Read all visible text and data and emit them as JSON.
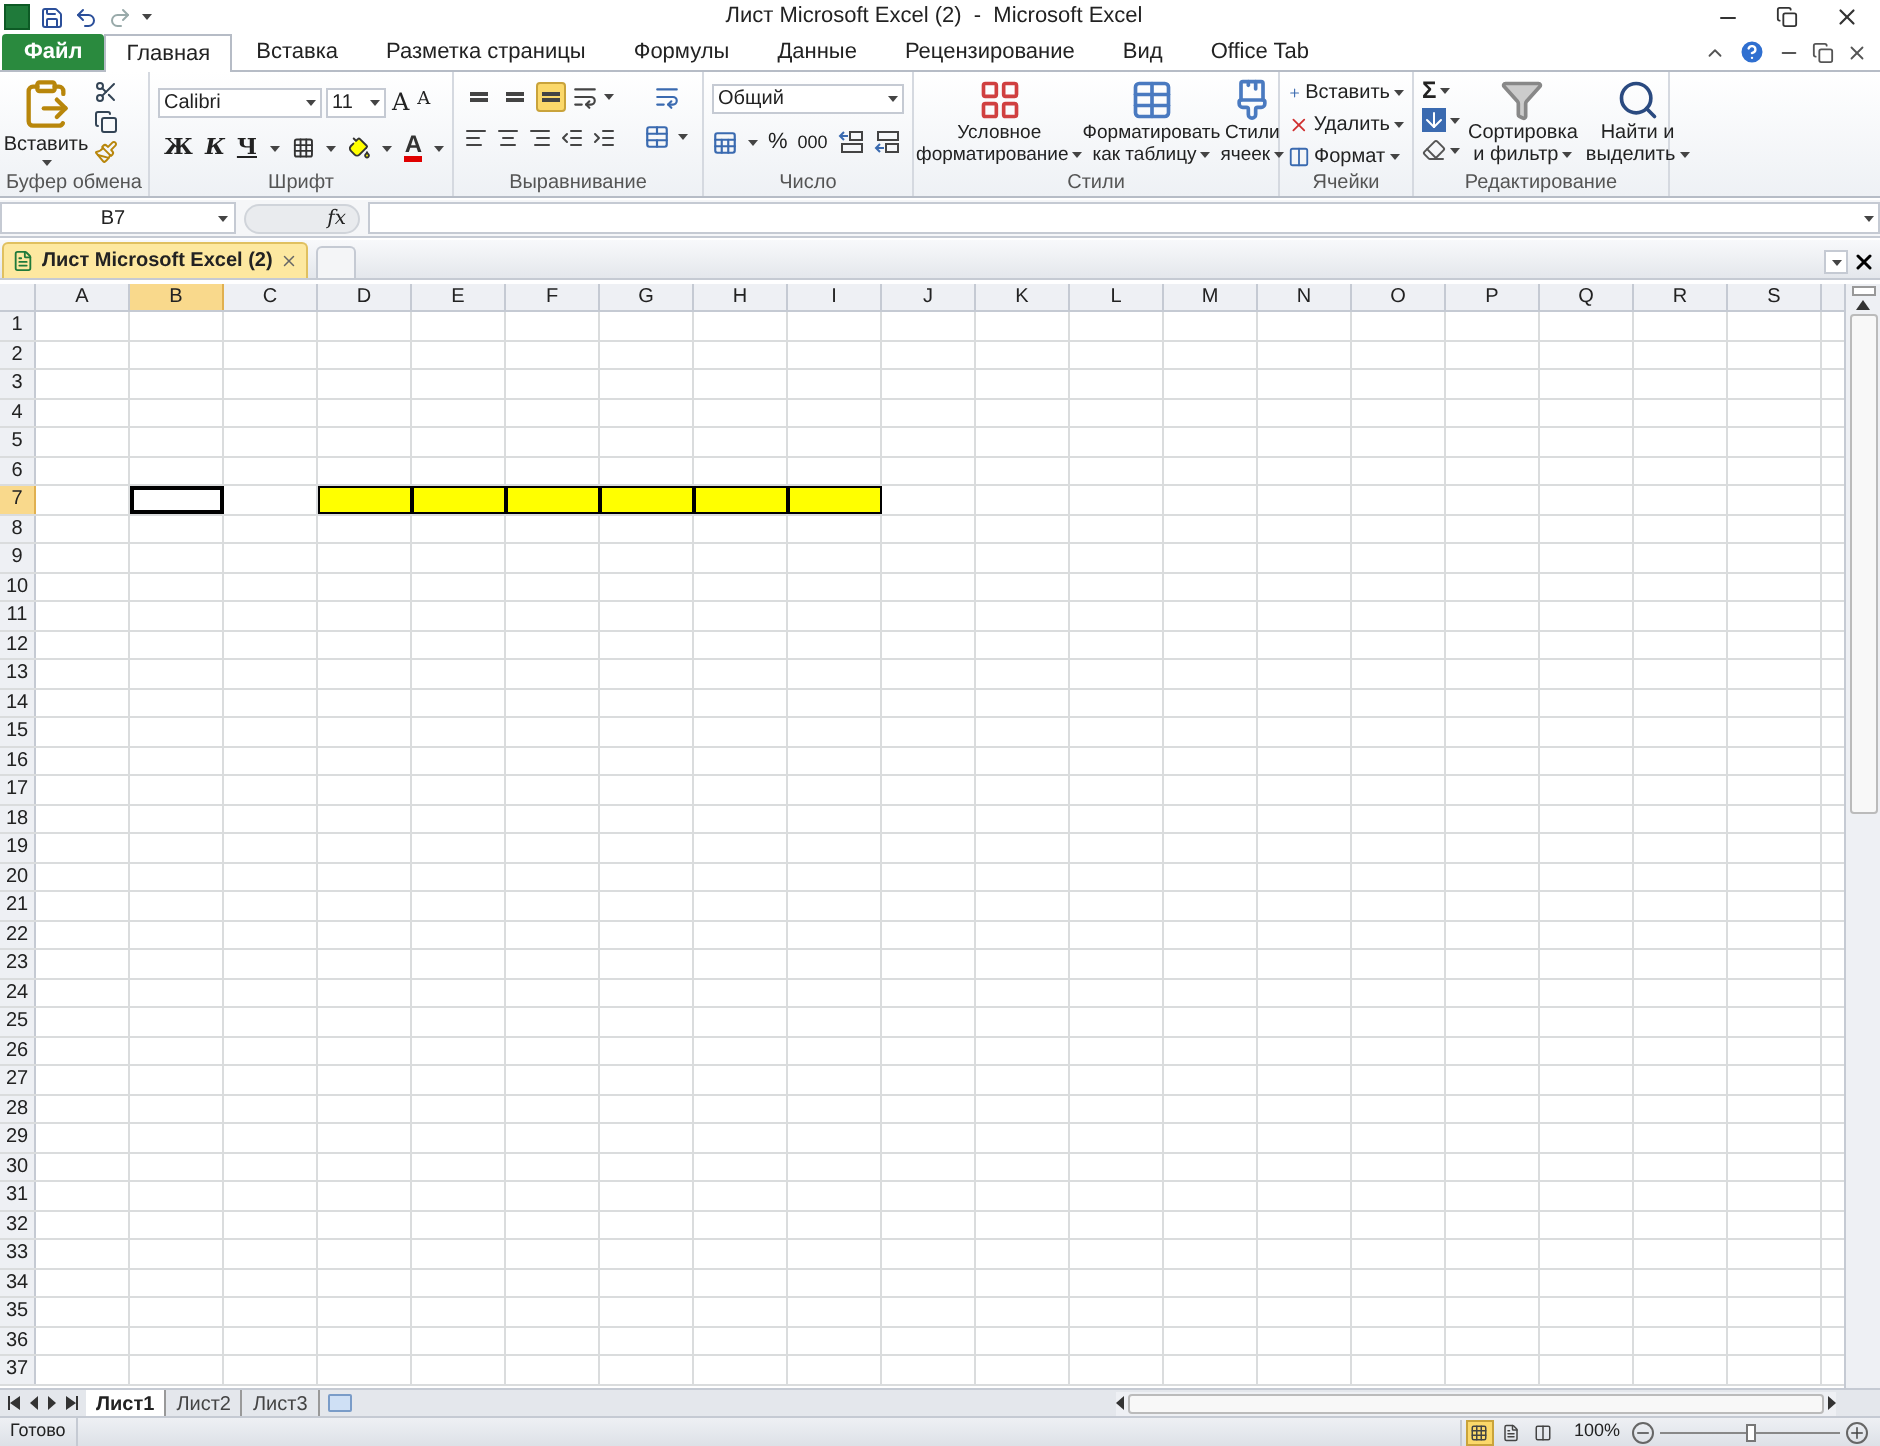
{
  "window": {
    "title": "Лист Microsoft Excel (2)  -  Microsoft Excel"
  },
  "ribbon_tabs": [
    {
      "label": "Файл",
      "kind": "file",
      "selected": false
    },
    {
      "label": "Главная",
      "kind": "tab",
      "selected": true
    },
    {
      "label": "Вставка",
      "kind": "tab",
      "selected": false
    },
    {
      "label": "Разметка страницы",
      "kind": "tab",
      "selected": false
    },
    {
      "label": "Формулы",
      "kind": "tab",
      "selected": false
    },
    {
      "label": "Данные",
      "kind": "tab",
      "selected": false
    },
    {
      "label": "Рецензирование",
      "kind": "tab",
      "selected": false
    },
    {
      "label": "Вид",
      "kind": "tab",
      "selected": false
    },
    {
      "label": "Office Tab",
      "kind": "tab",
      "selected": false
    }
  ],
  "clipboard": {
    "title": "Буфер обмена",
    "paste_label": "Вставить"
  },
  "font": {
    "title": "Шрифт",
    "name": "Calibri",
    "size": "11",
    "grow_glyph": "A",
    "shrink_glyph": "A",
    "bold": "Ж",
    "italic": "К",
    "underline": "Ч",
    "color_glyph": "A"
  },
  "alignment": {
    "title": "Выравнивание",
    "vertical": [
      {
        "selected": false
      },
      {
        "selected": false
      },
      {
        "selected": true
      }
    ]
  },
  "number": {
    "title": "Число",
    "format": "Общий",
    "percent": "%",
    "thousands": "000"
  },
  "styles": {
    "title": "Стили",
    "buttons": [
      {
        "lines": [
          "Условное",
          "форматирование"
        ]
      },
      {
        "lines": [
          "Форматировать",
          "как таблицу"
        ]
      },
      {
        "lines": [
          "Стили",
          "ячеек"
        ]
      }
    ]
  },
  "cells": {
    "title": "Ячейки",
    "buttons": [
      "Вставить",
      "Удалить",
      "Формат"
    ]
  },
  "editing": {
    "title": "Редактирование",
    "sum_glyph": "Σ",
    "buttons": [
      {
        "lines": [
          "Сортировка",
          "и фильтр"
        ]
      },
      {
        "lines": [
          "Найти и",
          "выделить"
        ]
      }
    ]
  },
  "formula_bar": {
    "name_box": "B7",
    "fx": "fx"
  },
  "doc_tabs": [
    {
      "label": "Лист Microsoft Excel (2)",
      "selected": true
    }
  ],
  "sheet": {
    "columns": [
      {
        "label": "A",
        "selected": false
      },
      {
        "label": "B",
        "selected": true
      },
      {
        "label": "C",
        "selected": false
      },
      {
        "label": "D",
        "selected": false
      },
      {
        "label": "E",
        "selected": false
      },
      {
        "label": "F",
        "selected": false
      },
      {
        "label": "G",
        "selected": false
      },
      {
        "label": "H",
        "selected": false
      },
      {
        "label": "I",
        "selected": false
      },
      {
        "label": "J",
        "selected": false
      },
      {
        "label": "K",
        "selected": false
      },
      {
        "label": "L",
        "selected": false
      },
      {
        "label": "M",
        "selected": false
      },
      {
        "label": "N",
        "selected": false
      },
      {
        "label": "O",
        "selected": false
      },
      {
        "label": "P",
        "selected": false
      },
      {
        "label": "Q",
        "selected": false
      },
      {
        "label": "R",
        "selected": false
      },
      {
        "label": "S",
        "selected": false
      }
    ],
    "rows": [
      {
        "label": "1",
        "selected": false
      },
      {
        "label": "2",
        "selected": false
      },
      {
        "label": "3",
        "selected": false
      },
      {
        "label": "4",
        "selected": false
      },
      {
        "label": "5",
        "selected": false
      },
      {
        "label": "6",
        "selected": false
      },
      {
        "label": "7",
        "selected": true,
        "cells": [
          {
            "filled": false,
            "active": false
          },
          {
            "filled": false,
            "active": true
          },
          {
            "filled": false,
            "active": false
          },
          {
            "filled": true,
            "active": false
          },
          {
            "filled": true,
            "active": false
          },
          {
            "filled": true,
            "active": false
          },
          {
            "filled": true,
            "active": false
          },
          {
            "filled": true,
            "active": false
          },
          {
            "filled": true,
            "active": false
          },
          {
            "filled": false,
            "active": false
          },
          {
            "filled": false,
            "active": false
          },
          {
            "filled": false,
            "active": false
          },
          {
            "filled": false,
            "active": false
          },
          {
            "filled": false,
            "active": false
          },
          {
            "filled": false,
            "active": false
          },
          {
            "filled": false,
            "active": false
          },
          {
            "filled": false,
            "active": false
          },
          {
            "filled": false,
            "active": false
          },
          {
            "filled": false,
            "active": false
          }
        ]
      },
      {
        "label": "8",
        "selected": false
      },
      {
        "label": "9",
        "selected": false
      },
      {
        "label": "10",
        "selected": false
      },
      {
        "label": "11",
        "selected": false
      },
      {
        "label": "12",
        "selected": false
      },
      {
        "label": "13",
        "selected": false
      },
      {
        "label": "14",
        "selected": false
      },
      {
        "label": "15",
        "selected": false
      },
      {
        "label": "16",
        "selected": false
      },
      {
        "label": "17",
        "selected": false
      },
      {
        "label": "18",
        "selected": false
      },
      {
        "label": "19",
        "selected": false
      },
      {
        "label": "20",
        "selected": false
      },
      {
        "label": "21",
        "selected": false
      },
      {
        "label": "22",
        "selected": false
      },
      {
        "label": "23",
        "selected": false
      },
      {
        "label": "24",
        "selected": false
      },
      {
        "label": "25",
        "selected": false
      },
      {
        "label": "26",
        "selected": false
      },
      {
        "label": "27",
        "selected": false
      },
      {
        "label": "28",
        "selected": false
      },
      {
        "label": "29",
        "selected": false
      },
      {
        "label": "30",
        "selected": false
      },
      {
        "label": "31",
        "selected": false
      },
      {
        "label": "32",
        "selected": false
      },
      {
        "label": "33",
        "selected": false
      },
      {
        "label": "34",
        "selected": false
      },
      {
        "label": "35",
        "selected": false
      },
      {
        "label": "36",
        "selected": false
      },
      {
        "label": "37",
        "selected": false
      }
    ]
  },
  "sheet_tabs": [
    {
      "label": "Лист1",
      "selected": true
    },
    {
      "label": "Лист2",
      "selected": false
    },
    {
      "label": "Лист3",
      "selected": false
    }
  ],
  "status_bar": {
    "text": "Готово",
    "views": [
      {
        "selected": true
      },
      {
        "selected": false
      },
      {
        "selected": false
      }
    ],
    "zoom": "100%",
    "zoom_slider": {
      "level": 0.5
    }
  }
}
